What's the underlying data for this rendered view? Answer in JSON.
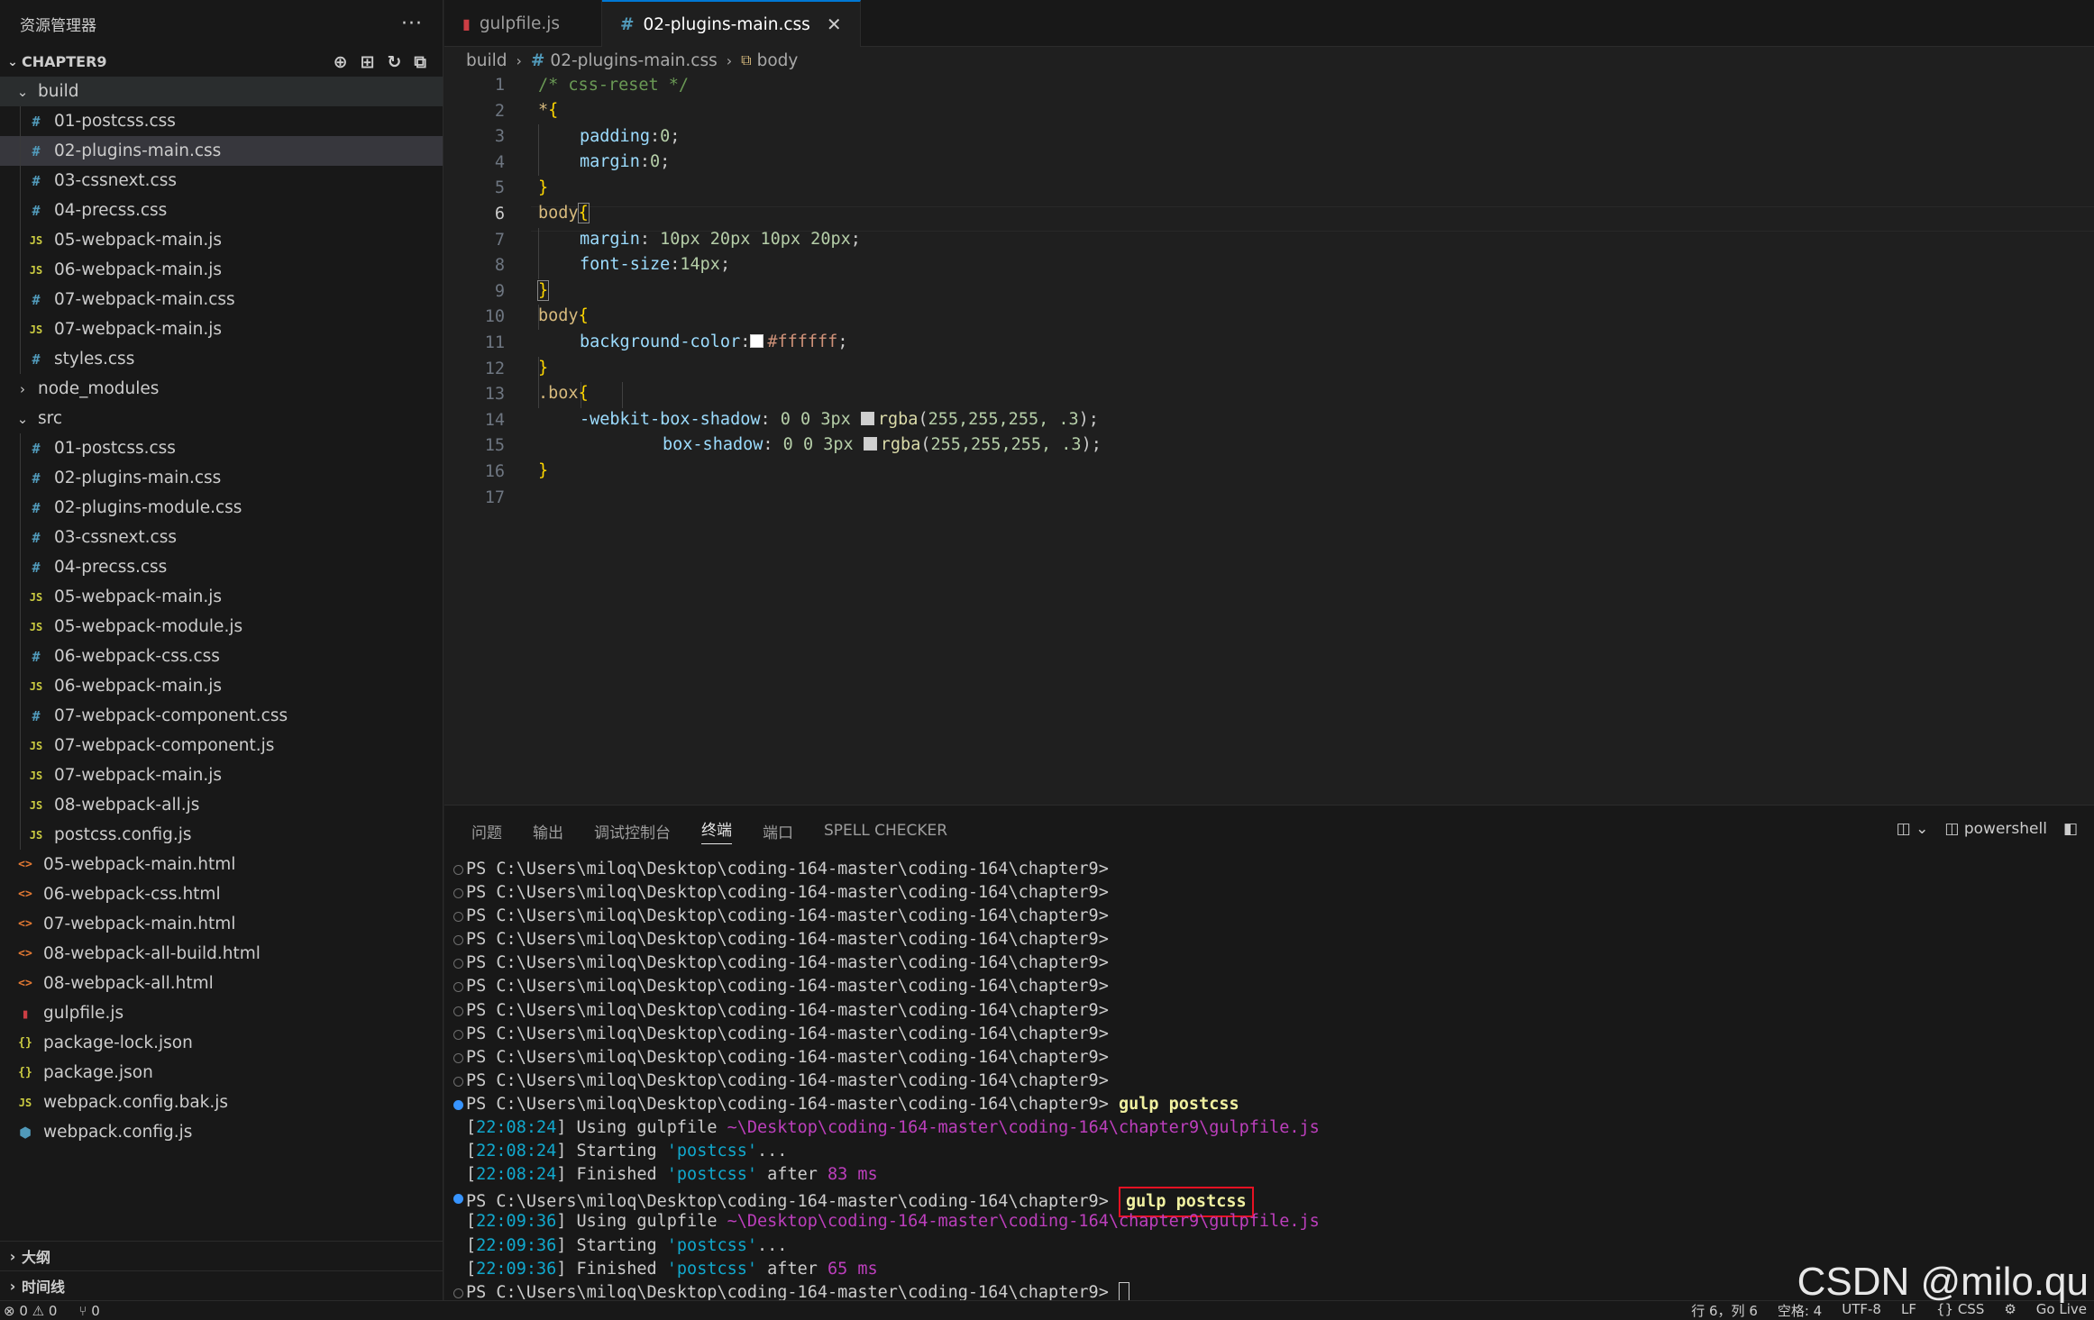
{
  "sidebar": {
    "title": "资源管理器",
    "more": "···",
    "section": "CHAPTER9",
    "actions": [
      "⊕",
      "⊞",
      "↻",
      "⧉"
    ],
    "tree": [
      {
        "label": "build",
        "type": "folder",
        "open": true,
        "depth": 0
      },
      {
        "label": "01-postcss.css",
        "type": "css",
        "depth": 1
      },
      {
        "label": "02-plugins-main.css",
        "type": "css",
        "depth": 1,
        "selected": true
      },
      {
        "label": "03-cssnext.css",
        "type": "css",
        "depth": 1
      },
      {
        "label": "04-precss.css",
        "type": "css",
        "depth": 1
      },
      {
        "label": "05-webpack-main.js",
        "type": "js",
        "depth": 1
      },
      {
        "label": "06-webpack-main.js",
        "type": "js",
        "depth": 1
      },
      {
        "label": "07-webpack-main.css",
        "type": "css",
        "depth": 1
      },
      {
        "label": "07-webpack-main.js",
        "type": "js",
        "depth": 1
      },
      {
        "label": "styles.css",
        "type": "css",
        "depth": 1
      },
      {
        "label": "node_modules",
        "type": "folder",
        "open": false,
        "depth": 0
      },
      {
        "label": "src",
        "type": "folder",
        "open": true,
        "depth": 0
      },
      {
        "label": "01-postcss.css",
        "type": "css",
        "depth": 1
      },
      {
        "label": "02-plugins-main.css",
        "type": "css",
        "depth": 1
      },
      {
        "label": "02-plugins-module.css",
        "type": "css",
        "depth": 1
      },
      {
        "label": "03-cssnext.css",
        "type": "css",
        "depth": 1
      },
      {
        "label": "04-precss.css",
        "type": "css",
        "depth": 1
      },
      {
        "label": "05-webpack-main.js",
        "type": "js",
        "depth": 1
      },
      {
        "label": "05-webpack-module.js",
        "type": "js",
        "depth": 1
      },
      {
        "label": "06-webpack-css.css",
        "type": "css",
        "depth": 1
      },
      {
        "label": "06-webpack-main.js",
        "type": "js",
        "depth": 1
      },
      {
        "label": "07-webpack-component.css",
        "type": "css",
        "depth": 1
      },
      {
        "label": "07-webpack-component.js",
        "type": "js",
        "depth": 1
      },
      {
        "label": "07-webpack-main.js",
        "type": "js",
        "depth": 1
      },
      {
        "label": "08-webpack-all.js",
        "type": "js",
        "depth": 1
      },
      {
        "label": "postcss.config.js",
        "type": "js",
        "depth": 1
      },
      {
        "label": "05-webpack-main.html",
        "type": "html",
        "depth": 0
      },
      {
        "label": "06-webpack-css.html",
        "type": "html",
        "depth": 0
      },
      {
        "label": "07-webpack-main.html",
        "type": "html",
        "depth": 0
      },
      {
        "label": "08-webpack-all-build.html",
        "type": "html",
        "depth": 0
      },
      {
        "label": "08-webpack-all.html",
        "type": "html",
        "depth": 0
      },
      {
        "label": "gulpfile.js",
        "type": "gulp",
        "depth": 0
      },
      {
        "label": "package-lock.json",
        "type": "json",
        "depth": 0
      },
      {
        "label": "package.json",
        "type": "json",
        "depth": 0
      },
      {
        "label": "webpack.config.bak.js",
        "type": "js",
        "depth": 0
      },
      {
        "label": "webpack.config.js",
        "type": "webpack",
        "depth": 0
      }
    ],
    "outline": "大纲",
    "timeline": "时间线"
  },
  "icons": {
    "css": {
      "glyph": "#",
      "color": "#519aba"
    },
    "js": {
      "glyph": "JS",
      "color": "#cbcb41"
    },
    "html": {
      "glyph": "<>",
      "color": "#e37933"
    },
    "json": {
      "glyph": "{}",
      "color": "#cbcb41"
    },
    "gulp": {
      "glyph": "▮",
      "color": "#cc3e44"
    },
    "webpack": {
      "glyph": "⬢",
      "color": "#519aba"
    }
  },
  "tabs": [
    {
      "label": "gulpfile.js",
      "icon": "gulp",
      "active": false
    },
    {
      "label": "02-plugins-main.css",
      "icon": "css",
      "active": true,
      "close": "✕"
    }
  ],
  "breadcrumb": {
    "folder": "build",
    "file": "02-plugins-main.css",
    "symbol": "body"
  },
  "editor": {
    "current_line": 6,
    "lines": [
      {
        "n": "1"
      },
      {
        "n": "2"
      },
      {
        "n": "3"
      },
      {
        "n": "4"
      },
      {
        "n": "5"
      },
      {
        "n": "6"
      },
      {
        "n": "7"
      },
      {
        "n": "8"
      },
      {
        "n": "9"
      },
      {
        "n": "10"
      },
      {
        "n": "11"
      },
      {
        "n": "12"
      },
      {
        "n": "13"
      },
      {
        "n": "14"
      },
      {
        "n": "15"
      },
      {
        "n": "16"
      },
      {
        "n": "17"
      }
    ],
    "code": {
      "l1": "/* css-reset */",
      "l2a": "*",
      "l2b": "{",
      "l3a": "padding",
      "l3b": ":",
      "l3c": "0",
      "l3d": ";",
      "l4a": "margin",
      "l4b": ":",
      "l4c": "0",
      "l4d": ";",
      "l5": "}",
      "l6a": "body",
      "l6b": "{",
      "l7a": "margin",
      "l7b": ": ",
      "l7c": "10px 20px 10px 20px",
      "l7d": ";",
      "l8a": "font-size",
      "l8b": ":",
      "l8c": "14px",
      "l8d": ";",
      "l9": "}",
      "l10a": "body",
      "l10b": "{",
      "l11a": "background-color",
      "l11b": ":",
      "l11c": "#ffffff",
      "l11d": ";",
      "l12": "}",
      "l13a": ".box",
      "l13b": "{",
      "l14a": "-webkit-box-shadow",
      "l14b": ": ",
      "l14c": "0 0 3px ",
      "l14d": "rgba",
      "l14e": "(",
      "l14f": "255,255,255, .3",
      "l14g": ");",
      "l15a": "box-shadow",
      "l15b": ": ",
      "l15c": "0 0 3px ",
      "l15d": "rgba",
      "l15e": "(",
      "l15f": "255,255,255, .3",
      "l15g": ");",
      "l16": "}"
    }
  },
  "panel": {
    "tabs": [
      "问题",
      "输出",
      "调试控制台",
      "终端",
      "端口",
      "SPELL CHECKER"
    ],
    "active_tab": "终端",
    "shell": "powershell",
    "prompt": "PS C:\\Users\\miloq\\Desktop\\coding-164-master\\coding-164\\chapter9>",
    "cmd": "gulp postcss",
    "run1": {
      "t1": "22:08:24",
      "t2": "22:08:24",
      "t3": "22:08:24",
      "using": "Using gulpfile ",
      "path": "~\\Desktop\\coding-164-master\\coding-164\\chapter9\\gulpfile.js",
      "starting": "Starting ",
      "task": "'postcss'",
      "dots": "...",
      "finished": "Finished ",
      "after": " after ",
      "ms": "83 ms"
    },
    "run2": {
      "t1": "22:09:36",
      "t2": "22:09:36",
      "t3": "22:09:36",
      "ms": "65 ms"
    }
  },
  "status": {
    "errors": "⊗ 0 ⚠ 0",
    "ports": "⑂ 0",
    "position": "行 6，列 6",
    "spaces": "空格: 4",
    "encoding": "UTF-8",
    "eol": "LF",
    "lang": "{} CSS",
    "golive": "Go Live"
  },
  "watermark": "CSDN @milo.qu"
}
